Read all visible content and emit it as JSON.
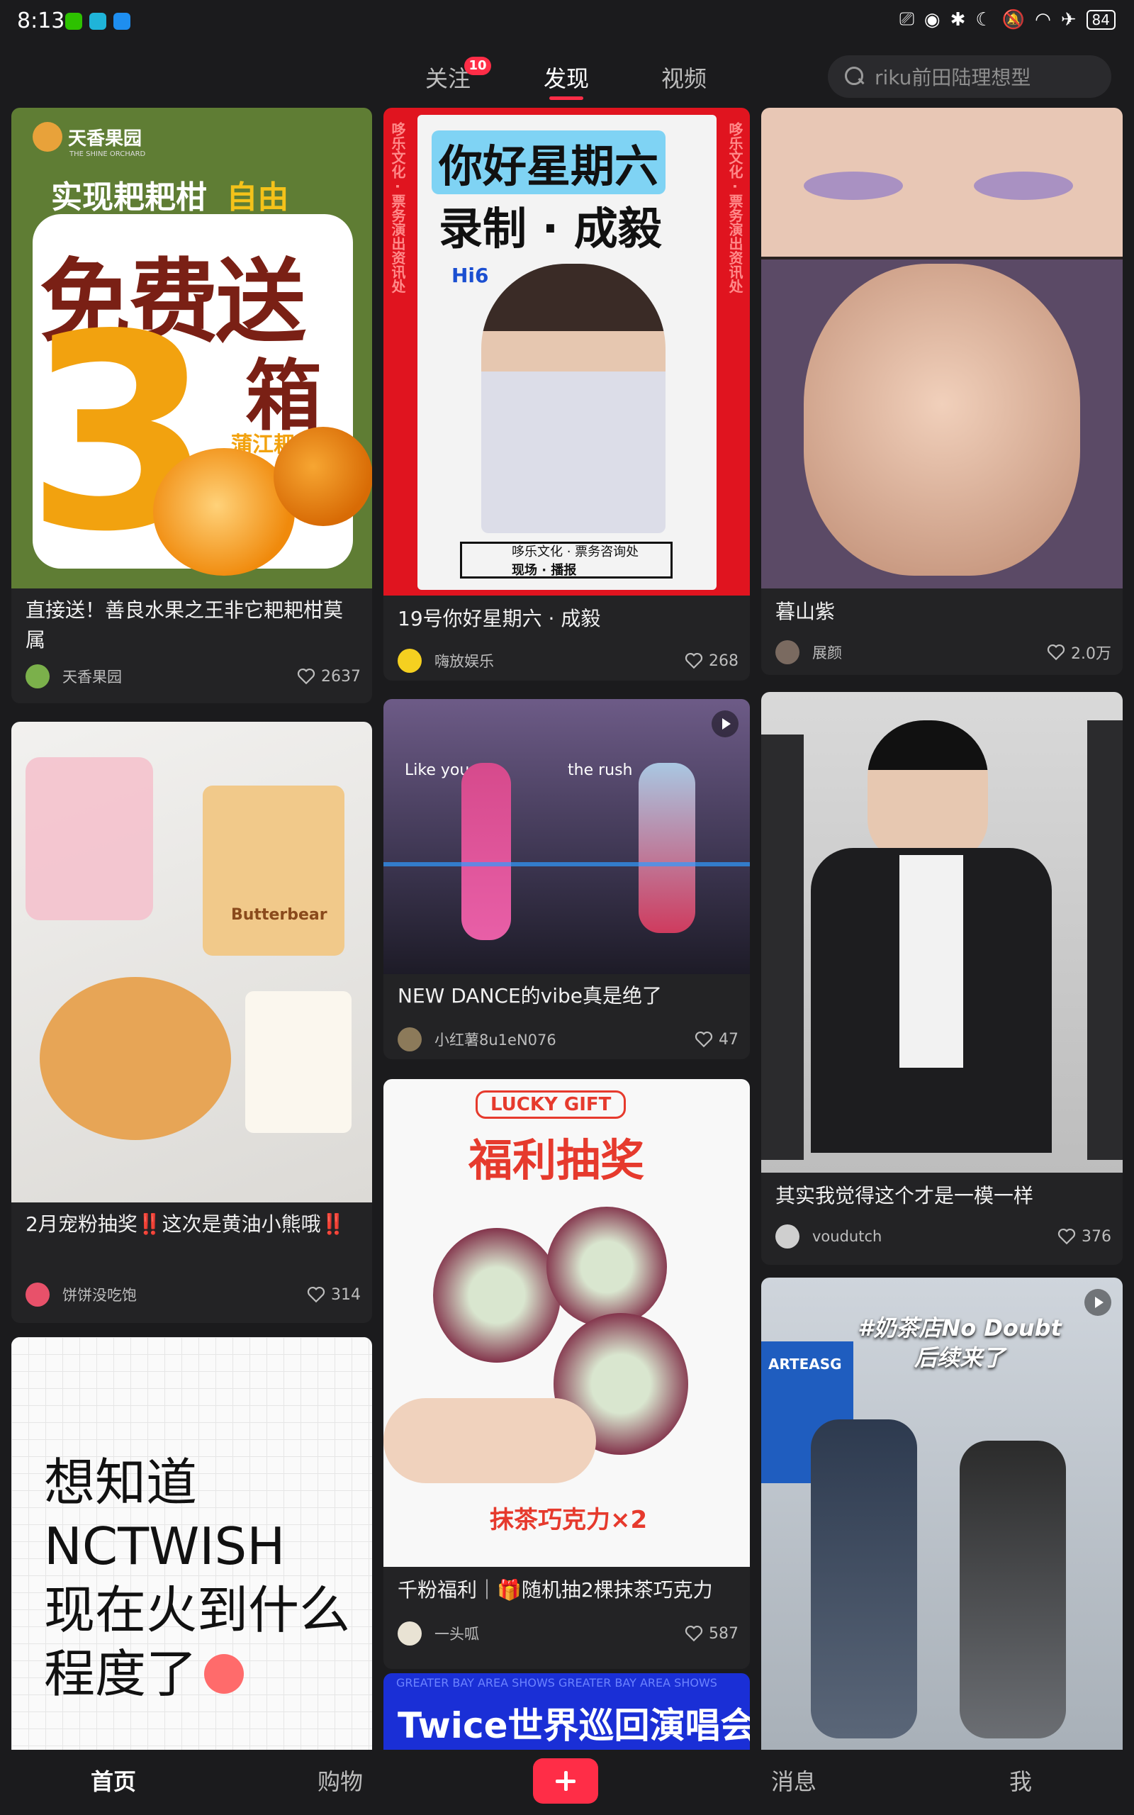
{
  "status_bar": {
    "time": "8:13",
    "battery": "84"
  },
  "nav": {
    "tabs": [
      {
        "label": "关注",
        "badge": "10"
      },
      {
        "label": "发现"
      },
      {
        "label": "视频"
      }
    ],
    "active_tab": "发现",
    "search_placeholder": "riku前田陆理想型"
  },
  "colors": {
    "accent": "#ff2d47",
    "background": "#1b1b1d",
    "card": "#232325"
  },
  "feed": {
    "col1": [
      {
        "title": "直接送！善良水果之王非它耙耙柑莫属",
        "author": "天香果园",
        "likes": "2637",
        "image_text": {
          "brand": "天香果园",
          "brand_en": "THE SHINE ORCHARD",
          "line1": "实现耙耙柑",
          "line1b": "自由",
          "big": "免费送",
          "num": "3",
          "unit": "箱",
          "sub": "蒲江耙耙柑"
        }
      },
      {
        "title": "2月宠粉抽奖‼️这次是黄油小熊哦‼️",
        "author": "饼饼没吃饱",
        "likes": "314",
        "image_text": {
          "label": "Butterbear"
        }
      },
      {
        "title": "",
        "image_text": {
          "l1": "想知道",
          "l2": "NCTWISH",
          "l3": "现在火到什么",
          "l4": "程度了"
        }
      }
    ],
    "col2": [
      {
        "title": "19号你好星期六 · 成毅",
        "author": "嗨放娱乐",
        "likes": "268",
        "image_text": {
          "h1": "你好星期六",
          "h2": "录制 · 成毅",
          "side": "哆乐文化 · 票务演出资讯处",
          "logo": "Hi6",
          "footer1": "哆乐文化 · 票务咨询处",
          "footer2": "现场 · 播报"
        }
      },
      {
        "title": "NEW DANCE的vibe真是绝了",
        "author": "小红薯8u1eN076",
        "likes": "47",
        "image_text": {
          "caption": "Like you",
          "caption2": "the rush"
        }
      },
      {
        "title": "千粉福利｜🎁随机抽2棵抹茶巧克力",
        "author": "一头呱",
        "likes": "587",
        "image_text": {
          "tag": "LUCKY GIFT",
          "big": "福利抽奖",
          "bottom": "抹茶巧克力×2"
        }
      },
      {
        "title": "",
        "image_text": {
          "top": "GREATER BAY AREA SHOWS GREATER BAY AREA SHOWS",
          "big": "Twice世界巡回演唱会"
        }
      }
    ],
    "col3": [
      {
        "title": "暮山紫",
        "author": "展颜",
        "likes": "2.0万"
      },
      {
        "title": "其实我觉得这个才是一模一样",
        "author": "voudutch",
        "likes": "376"
      },
      {
        "title": "",
        "image_text": {
          "l1": "#奶茶店No Doubt",
          "l2": "后续来了",
          "store": "ARTEASG"
        }
      }
    ]
  },
  "bottom_nav": {
    "home": "首页",
    "shop": "购物",
    "messages": "消息",
    "me": "我"
  }
}
